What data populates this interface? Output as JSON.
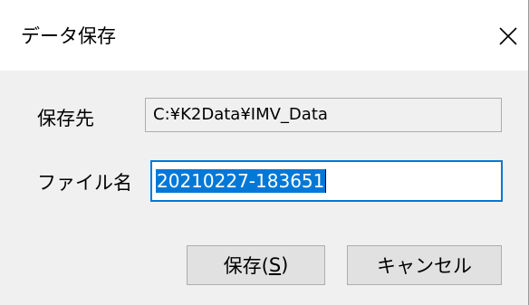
{
  "window": {
    "title": "データ保存",
    "close_icon": "close-icon"
  },
  "form": {
    "path_label": "保存先",
    "path_value": "C:¥K2Data¥IMV_Data",
    "filename_label": "ファイル名",
    "filename_value": "20210227-183651"
  },
  "buttons": {
    "save_label_prefix": "保存(",
    "save_mnemonic": "S",
    "save_label_suffix": ")",
    "cancel_label": "キャンセル"
  },
  "colors": {
    "accent": "#0078d7",
    "face": "#f0f0f0",
    "button_face": "#e1e1e1"
  }
}
